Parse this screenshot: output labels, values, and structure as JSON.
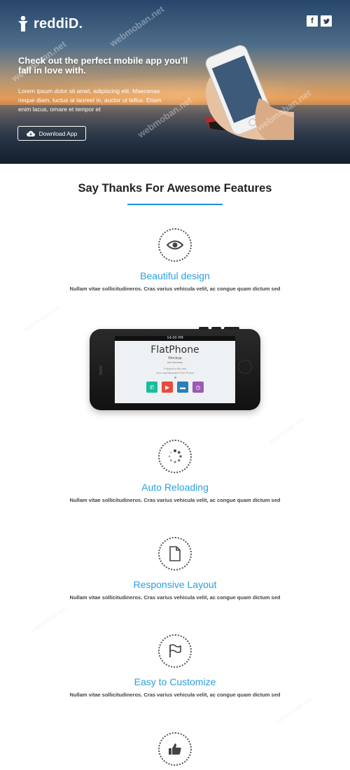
{
  "header": {
    "brand": "reddiD.",
    "social": [
      "f",
      "🐦"
    ],
    "headline": "Check out the perfect mobile app you'll fall in love with.",
    "body": "Lorem ipsum dolor sit amet, adipiscing elit. Maecenas neque diam, luctus at laoreet in, auctor ut tellus. Etiam enim lacus, ornare et tempor et",
    "download_label": "Download App"
  },
  "features_section": {
    "title": "Say Thanks For Awesome Features"
  },
  "features": [
    {
      "icon": "eye-icon",
      "title": "Beautiful design",
      "desc": "Nullam vitae sollicitudineros. Cras varius vehicula velit, ac congue quam dictum sed"
    },
    {
      "icon": "loading-icon",
      "title": "Auto Reloading",
      "desc": "Nullam vitae sollicitudineros. Cras varius vehicula velit, ac congue quam dictum sed"
    },
    {
      "icon": "document-icon",
      "title": "Responsive Layout",
      "desc": "Nullam vitae sollicitudineros. Cras varius vehicula velit, ac congue quam dictum sed"
    },
    {
      "icon": "flag-icon",
      "title": "Easy to Customize",
      "desc": "Nullam vitae sollicitudineros. Cras varius vehicula velit, ac congue quam dictum sed"
    },
    {
      "icon": "thumbs-up-icon",
      "title": "",
      "desc": ""
    }
  ],
  "phone_mockup": {
    "status_time": "14:00 PM",
    "title": "FlatPhone",
    "subtitle": "Mockup",
    "tag": "New Business",
    "line1": "Fullyedit a file and",
    "line2": "Your sophisticated PSD Phone",
    "apps": [
      {
        "icon": "phone-icon",
        "color": "#1abc9c",
        "glyph": "✆"
      },
      {
        "icon": "play-icon",
        "color": "#e74c3c",
        "glyph": "▶"
      },
      {
        "icon": "chat-icon",
        "color": "#2980b9",
        "glyph": "▬"
      },
      {
        "icon": "clock-icon",
        "color": "#9b59b6",
        "glyph": "◷"
      }
    ]
  },
  "colors": {
    "accent": "#2aa0e2",
    "rule": "#1d8fe0"
  }
}
